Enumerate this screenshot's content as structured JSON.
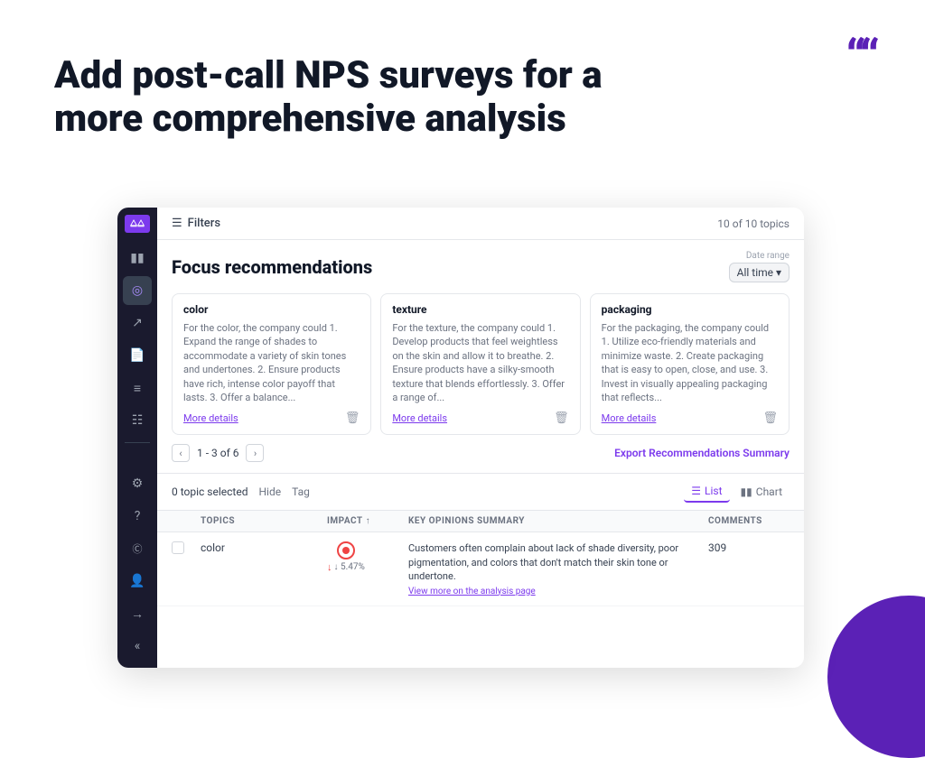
{
  "heading": {
    "line1": "Add post-call NPS surveys for a",
    "line2": "more comprehensive analysis"
  },
  "quote_symbol": "❝",
  "topbar": {
    "filters_label": "Filters",
    "topics_count": "10 of 10 topics"
  },
  "focus": {
    "title": "Focus recommendations",
    "date_range_label": "Date range",
    "date_range_value": "All time ▾"
  },
  "cards": [
    {
      "title": "color",
      "text": "For the color, the company could 1. Expand the range of shades to accommodate a variety of skin tones and undertones. 2. Ensure products have rich, intense color payoff that lasts. 3. Offer a balance...",
      "more_details": "More details"
    },
    {
      "title": "texture",
      "text": "For the texture, the company could 1. Develop products that feel weightless on the skin and allow it to breathe. 2. Ensure products have a silky-smooth texture that blends effortlessly. 3. Offer a range of...",
      "more_details": "More details"
    },
    {
      "title": "packaging",
      "text": "For the packaging, the company could 1. Utilize eco-friendly materials and minimize waste. 2. Create packaging that is easy to open, close, and use. 3. Invest in visually appealing packaging that reflects...",
      "more_details": "More details"
    }
  ],
  "pagination": {
    "text": "1 - 3 of 6",
    "prev_label": "‹",
    "next_label": "›"
  },
  "export_btn": "Export Recommendations Summary",
  "toolbar": {
    "selected": "0 topic selected",
    "hide": "Hide",
    "tag": "Tag",
    "list_view": "List",
    "chart_view": "Chart"
  },
  "table": {
    "headers": [
      "",
      "TOPICS",
      "IMPACT",
      "KEY OPINIONS SUMMARY",
      "COMMENTS"
    ],
    "rows": [
      {
        "topic": "color",
        "impact_pct": "↓ 5.47%",
        "summary": "Customers often complain about lack of shade diversity, poor pigmentation, and colors that don't match their skin tone or undertone.",
        "view_more": "View more on the analysis page",
        "comments": "309"
      }
    ]
  },
  "sidebar": {
    "icons": [
      "❝",
      "📊",
      "🎯",
      "📈",
      "📄",
      "≡",
      "📋",
      "⚙",
      "?",
      "©",
      "👤",
      "→",
      "«"
    ]
  },
  "colors": {
    "purple": "#7c3aed",
    "dark_bg": "#1a1a2e",
    "accent_circle": "#5b21b6"
  }
}
